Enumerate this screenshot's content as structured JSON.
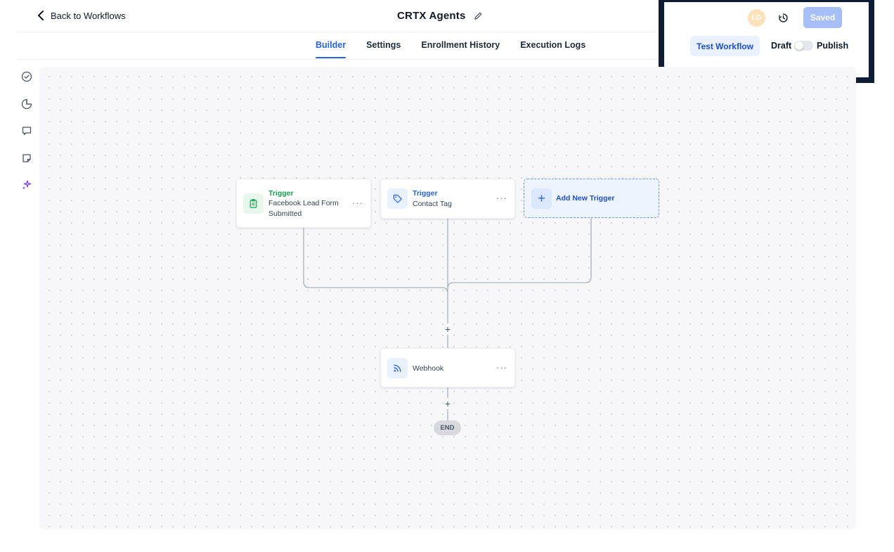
{
  "header": {
    "back_label": "Back to Workflows",
    "title": "CRTX Agents"
  },
  "tabs": [
    {
      "label": "Builder",
      "active": true
    },
    {
      "label": "Settings",
      "active": false
    },
    {
      "label": "Enrollment History",
      "active": false
    },
    {
      "label": "Execution Logs",
      "active": false
    }
  ],
  "toolbar": {
    "avatar_initials": "LG",
    "saved_label": "Saved",
    "test_label": "Test Workflow",
    "draft_label": "Draft",
    "publish_label": "Publish",
    "publish_toggle_on": false
  },
  "rail": {
    "icons": [
      "check-circle-icon",
      "pie-chart-icon",
      "comment-icon",
      "note-icon",
      "sparkle-icon"
    ]
  },
  "workflow": {
    "triggers": [
      {
        "kind": "Trigger",
        "description": "Facebook Lead Form Submitted",
        "icon": "clipboard-icon",
        "accent": "#16a34a"
      },
      {
        "kind": "Trigger",
        "description": "Contact Tag",
        "icon": "tag-icon",
        "accent": "#2563eb"
      }
    ],
    "add_trigger_label": "Add New Trigger",
    "actions": [
      {
        "description": "Webhook",
        "icon": "webhook-icon"
      }
    ],
    "end_label": "END"
  },
  "colors": {
    "accent": "#2563eb",
    "saved_button": "#a6bff8",
    "highlight_border": "#0f1c35"
  }
}
